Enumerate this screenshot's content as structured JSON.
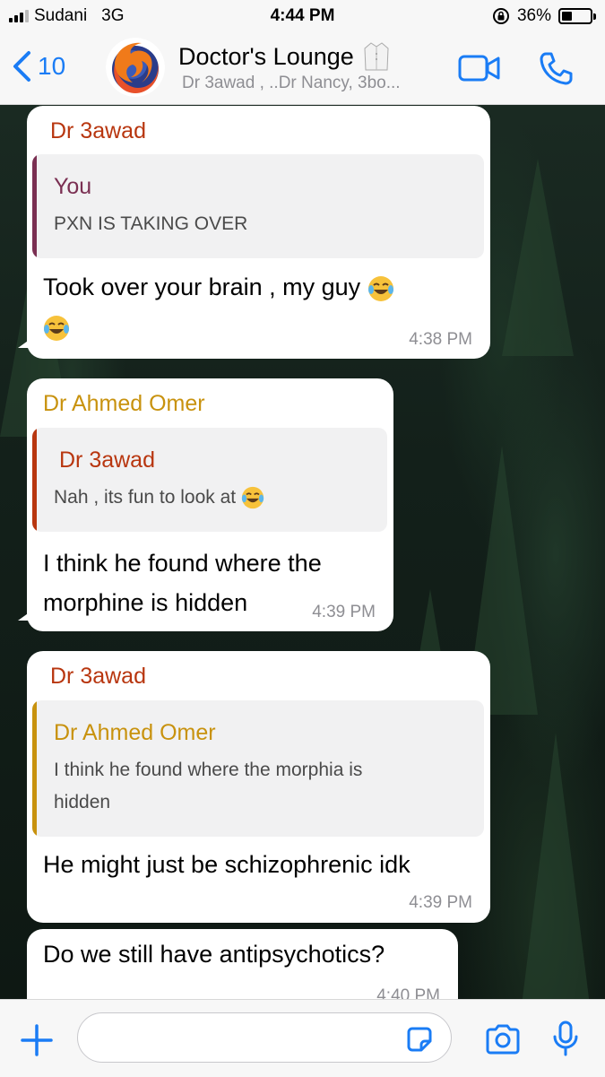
{
  "status": {
    "carrier": "Sudani",
    "network": "3G",
    "time": "4:44 PM",
    "battery": "36%",
    "battery_level": 0.36
  },
  "header": {
    "back_count": "10",
    "title": "Doctor's Lounge",
    "subtitle": "Dr 3awad , ..Dr Nancy, 3bo..."
  },
  "messages": [
    {
      "sender": "Dr 3awad",
      "sender_color": "#b8360f",
      "quote_author": "You",
      "quote_author_color": "#7a2f52",
      "quote_text": "PXN IS TAKING OVER",
      "text_line1": "Took over your brain , my guy",
      "text_line2": "",
      "time": "4:38 PM"
    },
    {
      "sender": "Dr Ahmed Omer",
      "sender_color": "#c8920e",
      "quote_author": "Dr 3awad",
      "quote_author_color": "#b8360f",
      "quote_text": "Nah , its fun to look at",
      "text_line1": "I think he found where the",
      "text_line2": "morphine is hidden",
      "time": "4:39 PM"
    },
    {
      "sender": "Dr 3awad",
      "sender_color": "#b8360f",
      "quote_author": "Dr Ahmed Omer",
      "quote_author_color": "#c8920e",
      "quote_text_line1": "I think he found where the morphia is",
      "quote_text_line2": "hidden",
      "text_line1": "He might just be schizophrenic idk",
      "time": "4:39 PM"
    },
    {
      "text_line1": "Do we still have antipsychotics?",
      "time": "4:40 PM"
    }
  ],
  "input": {
    "placeholder": ""
  },
  "colors": {
    "accent": "#1a7cf5",
    "bubble": "#ffffff"
  }
}
